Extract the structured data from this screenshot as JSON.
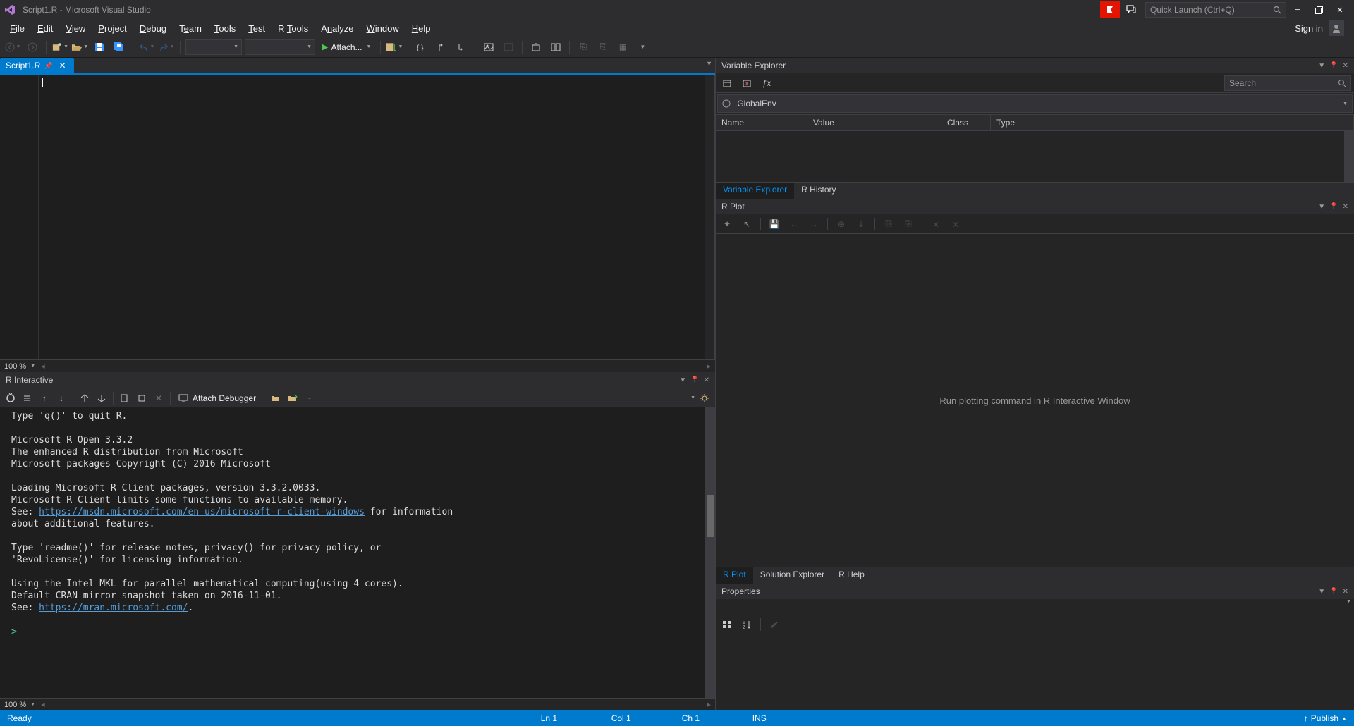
{
  "title": "Script1.R - Microsoft Visual Studio",
  "quick_launch_placeholder": "Quick Launch (Ctrl+Q)",
  "menu": [
    "File",
    "Edit",
    "View",
    "Project",
    "Debug",
    "Team",
    "Tools",
    "Test",
    "R Tools",
    "Analyze",
    "Window",
    "Help"
  ],
  "menu_underline_idx": [
    0,
    0,
    0,
    0,
    0,
    1,
    0,
    0,
    2,
    1,
    0,
    0
  ],
  "signin": "Sign in",
  "attach_label": "Attach...",
  "editor_tab": {
    "label": "Script1.R"
  },
  "zoom": "100 %",
  "r_interactive": {
    "title": "R Interactive",
    "attach_debugger": "Attach Debugger",
    "working_dir": "~",
    "lines": [
      "Type 'q()' to quit R.",
      "",
      "Microsoft R Open 3.3.2",
      "The enhanced R distribution from Microsoft",
      "Microsoft packages Copyright (C) 2016 Microsoft",
      "",
      "Loading Microsoft R Client packages, version 3.3.2.0033.",
      "Microsoft R Client limits some functions to available memory."
    ],
    "see_line_prefix": "See: ",
    "link1": "https://msdn.microsoft.com/en-us/microsoft-r-client-windows",
    "see_suffix": " for information",
    "about_line": "about additional features.",
    "readme_line": "Type 'readme()' for release notes, privacy() for privacy policy, or",
    "revo_line": "'RevoLicense()' for licensing information.",
    "mkl_line": "Using the Intel MKL for parallel mathematical computing(using 4 cores).",
    "cran_line": "Default CRAN mirror snapshot taken on 2016-11-01.",
    "see2_prefix": "See: ",
    "link2": "https://mran.microsoft.com/",
    "see2_suffix": ".",
    "prompt": ">"
  },
  "variable_explorer": {
    "title": "Variable Explorer",
    "search_placeholder": "Search",
    "env": ".GlobalEnv",
    "columns": [
      "Name",
      "Value",
      "Class",
      "Type"
    ],
    "tabs": [
      "Variable Explorer",
      "R History"
    ]
  },
  "rplot": {
    "title": "R Plot",
    "placeholder": "Run plotting command in R Interactive Window",
    "tabs": [
      "R Plot",
      "Solution Explorer",
      "R Help"
    ]
  },
  "properties": {
    "title": "Properties"
  },
  "status": {
    "ready": "Ready",
    "ln": "Ln 1",
    "col": "Col 1",
    "ch": "Ch 1",
    "ins": "INS",
    "publish": "Publish"
  }
}
